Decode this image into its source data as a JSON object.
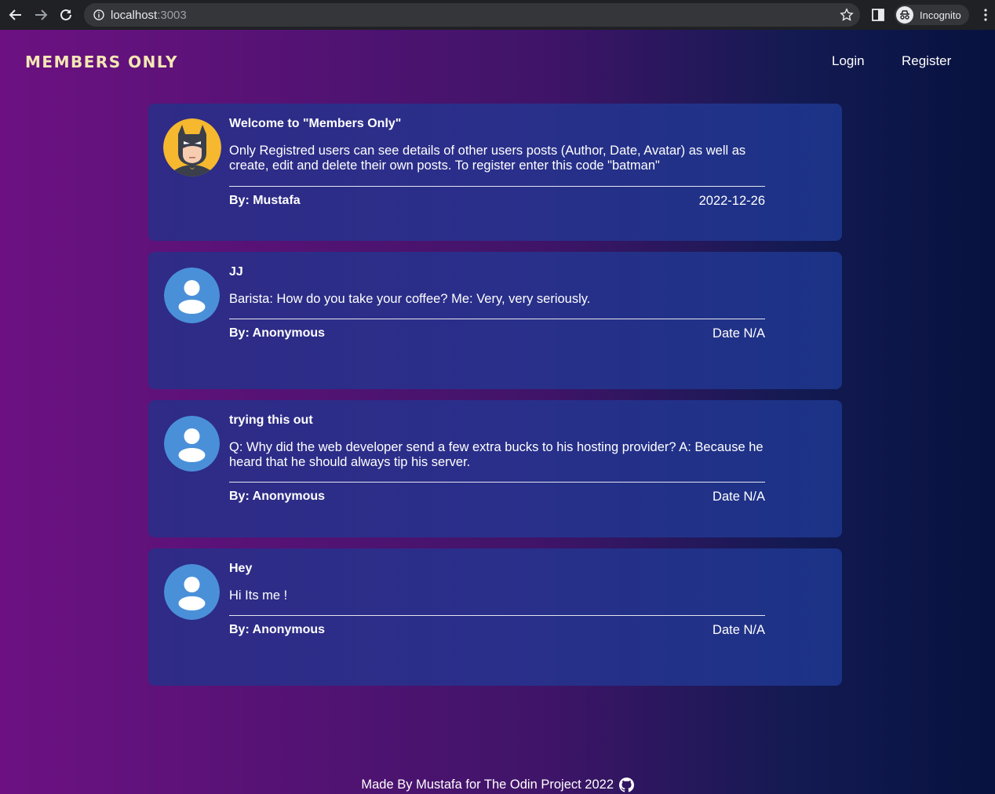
{
  "browser": {
    "url_host": "localhost",
    "url_port": ":3003",
    "profile_label": "Incognito"
  },
  "header": {
    "logo": "MEMBERS ONLY",
    "nav": {
      "login": "Login",
      "register": "Register"
    }
  },
  "posts": [
    {
      "title": "Welcome to \"Members Only\"",
      "body": "Only Registred users can see details of other users posts (Author, Date, Avatar) as well as create, edit and delete their own posts. To register enter this code \"batman\"",
      "author": "By: Mustafa",
      "date": "2022-12-26",
      "avatar": "batman-avatar"
    },
    {
      "title": "JJ",
      "body": "Barista: How do you take your coffee? Me: Very, very seriously.",
      "author": "By: Anonymous",
      "date": "Date N/A",
      "avatar": "user-avatar-icon"
    },
    {
      "title": "trying this out",
      "body": "Q: Why did the web developer send a few extra bucks to his hosting provider? A: Because he heard that he should always tip his server.",
      "author": "By: Anonymous",
      "date": "Date N/A",
      "avatar": "user-avatar-icon"
    },
    {
      "title": "Hey",
      "body": "Hi Its me !",
      "author": "By: Anonymous",
      "date": "Date N/A",
      "avatar": "user-avatar-icon"
    }
  ],
  "footer": {
    "text": "Made By Mustafa for The Odin Project 2022",
    "icon": "github-icon"
  },
  "colors": {
    "logo": "#f4e7b4",
    "card": "#2a2f8a",
    "avatar_blue": "#4a90d9"
  }
}
